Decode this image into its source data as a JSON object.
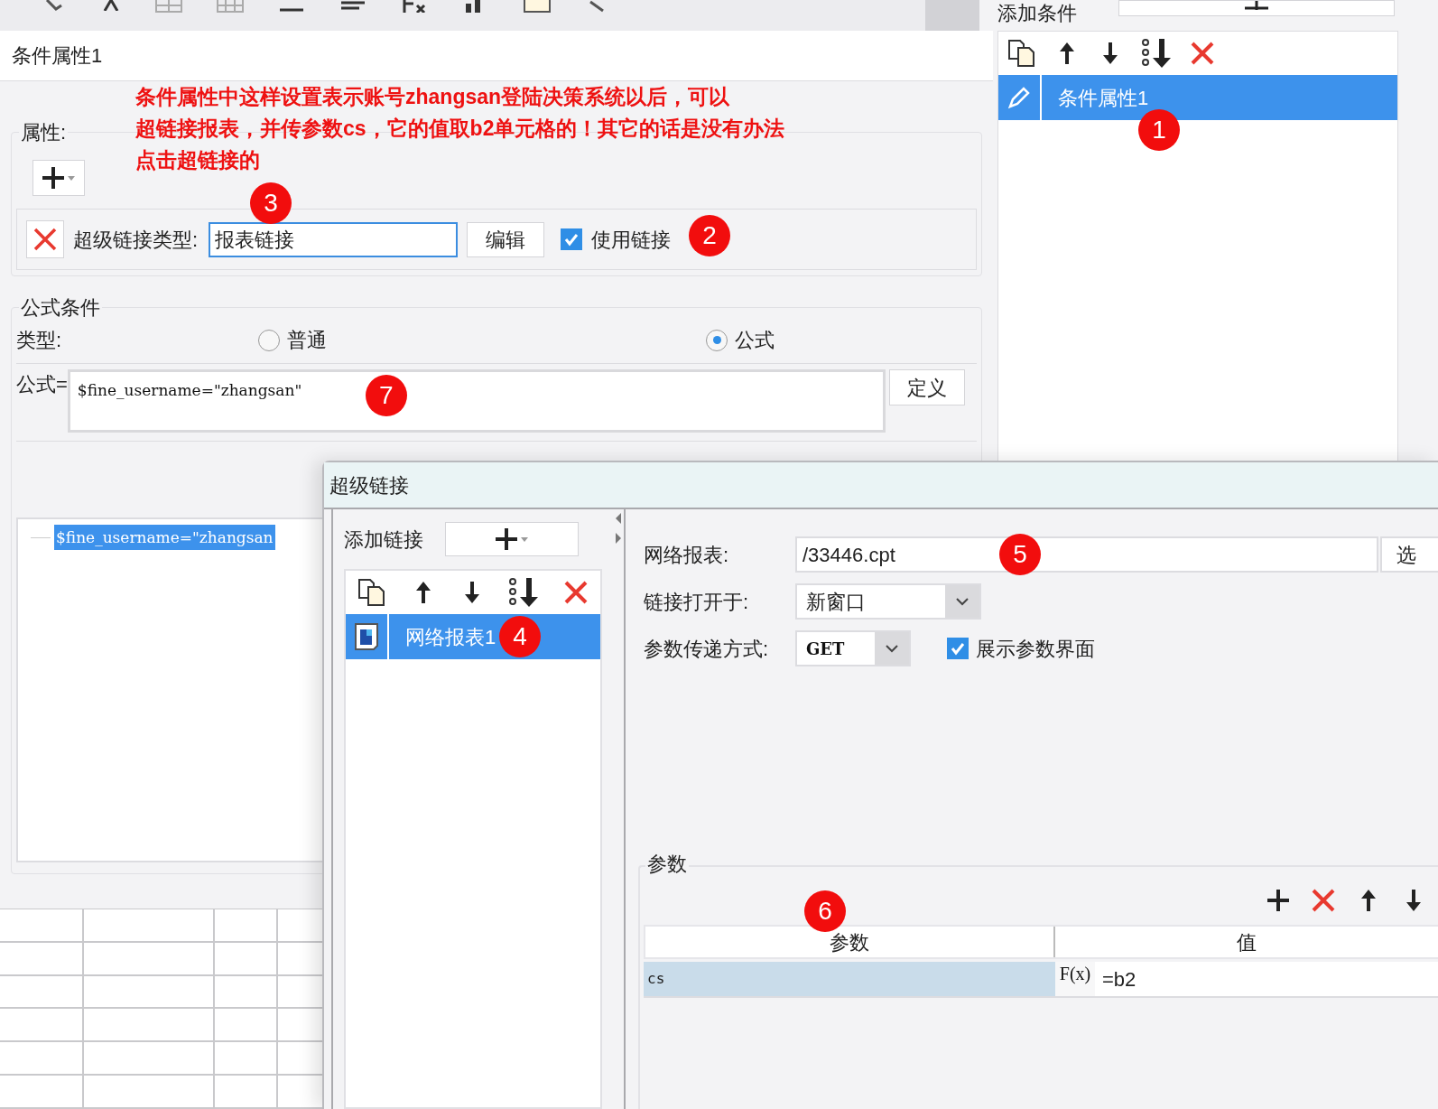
{
  "top_bar": {
    "add_condition_label": "添加条件"
  },
  "editor": {
    "title": "条件属性1",
    "note_lines": [
      "条件属性中这样设置表示账号zhangsan登陆决策系统以后，可以",
      "超链接报表，并传参数cs，它的值取b2单元格的！其它的话是没有办法",
      "点击超链接的"
    ],
    "properties": {
      "legend": "属性:",
      "rows": [
        {
          "type_label": "超级链接类型:",
          "type_value": "报表链接",
          "badge": "3",
          "edit_button": "编辑",
          "use_link": {
            "label": "使用链接",
            "checked": true,
            "badge": "2"
          }
        }
      ]
    },
    "formula_condition": {
      "legend": "公式条件",
      "type_label": "类型:",
      "options": [
        {
          "label": "普通",
          "selected": false
        },
        {
          "label": "公式",
          "selected": true
        }
      ],
      "formula_label": "公式=",
      "formula": "$fine_username=\"zhangsan\"",
      "badge": "7",
      "define_button": "定义",
      "preview": "$fine_username=\"zhangsan"
    }
  },
  "conditions": {
    "items": [
      {
        "label": "条件属性1",
        "selected": true,
        "badge": "1"
      }
    ]
  },
  "dialog": {
    "title": "超级链接",
    "add_link_label": "添加链接",
    "links": [
      {
        "label": "网络报表1",
        "selected": true,
        "badge": "4"
      }
    ],
    "report_label": "网络报表:",
    "report_value": "/33446.cpt",
    "report_badge": "5",
    "choose_button": "选",
    "open_in_label": "链接打开于:",
    "open_in_value": "新窗口",
    "method_label": "参数传递方式:",
    "method_value": "GET",
    "show_params": {
      "label": "展示参数界面",
      "checked": true
    },
    "params": {
      "legend": "参数",
      "badge": "6",
      "columns": [
        "参数",
        "值"
      ],
      "rows": [
        {
          "name": "cs",
          "formula_button": "F(x)",
          "value": "=b2"
        }
      ]
    }
  }
}
